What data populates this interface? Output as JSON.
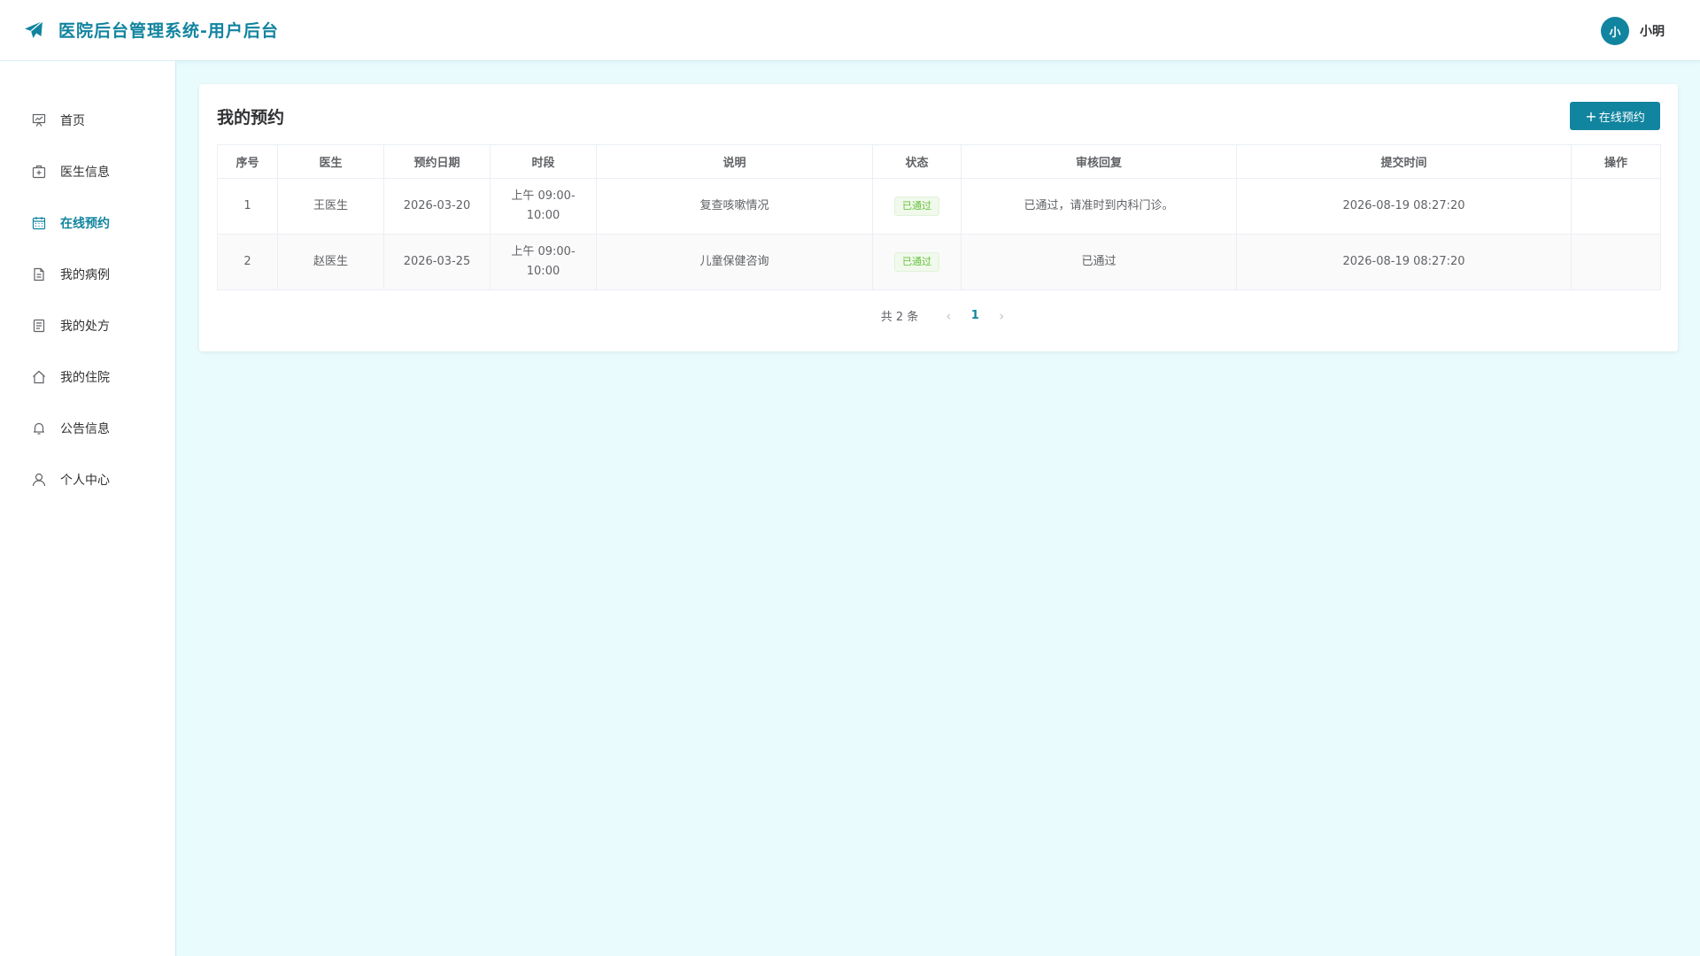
{
  "header": {
    "title": "医院后台管理系统-用户后台",
    "avatar_text": "小",
    "username": "小明"
  },
  "sidebar": {
    "items": [
      {
        "label": "首页",
        "icon": "presentation-chart-icon"
      },
      {
        "label": "医生信息",
        "icon": "medical-kit-icon"
      },
      {
        "label": "在线预约",
        "icon": "calendar-icon",
        "active": true
      },
      {
        "label": "我的病例",
        "icon": "document-icon"
      },
      {
        "label": "我的处方",
        "icon": "list-document-icon"
      },
      {
        "label": "我的住院",
        "icon": "house-icon"
      },
      {
        "label": "公告信息",
        "icon": "bell-icon"
      },
      {
        "label": "个人中心",
        "icon": "user-icon"
      }
    ]
  },
  "main": {
    "title": "我的预约",
    "add_button": "在线预约",
    "table": {
      "headers": [
        "序号",
        "医生",
        "预约日期",
        "时段",
        "说明",
        "状态",
        "审核回复",
        "提交时间",
        "操作"
      ],
      "rows": [
        {
          "index": "1",
          "doctor": "王医生",
          "date": "2026-03-20",
          "period_a": "上午 09:00-",
          "period_b": "10:00",
          "desc": "复查咳嗽情况",
          "status": "已通过",
          "reply": "已通过，请准时到内科门诊。",
          "submitted": "2026-08-19 08:27:20",
          "action": ""
        },
        {
          "index": "2",
          "doctor": "赵医生",
          "date": "2026-03-25",
          "period_a": "上午 09:00-",
          "period_b": "10:00",
          "desc": "儿童保健咨询",
          "status": "已通过",
          "reply": "已通过",
          "submitted": "2026-08-19 08:27:20",
          "action": ""
        }
      ]
    },
    "pagination": {
      "total": "共 2 条",
      "current": "1"
    }
  },
  "colors": {
    "accent": "#11849f",
    "background": "#e9fbfd",
    "success": "#67c23a"
  }
}
